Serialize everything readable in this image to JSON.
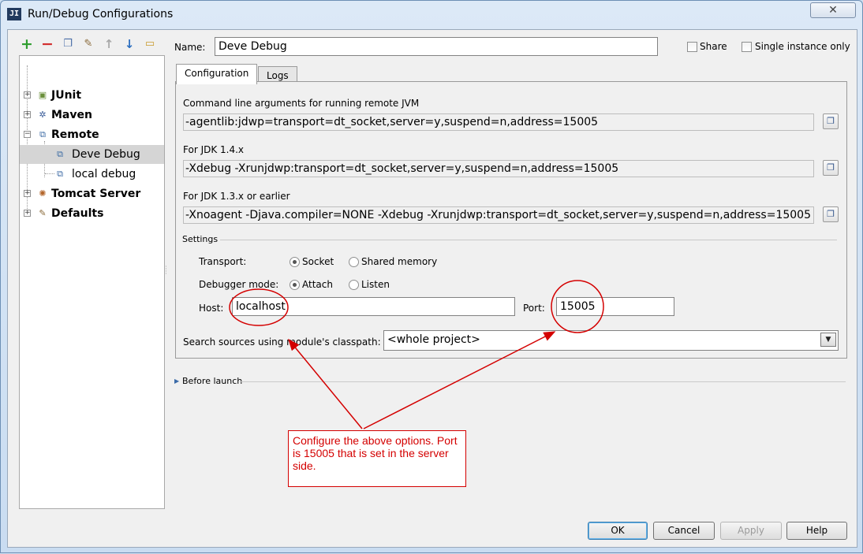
{
  "window": {
    "title": "Run/Debug Configurations",
    "app_icon_text": "JI",
    "close_glyph": "✕",
    "accent": "#d40000"
  },
  "toolbar": {
    "icons": [
      "add-icon",
      "remove-icon",
      "copy-icon",
      "wrench-icon",
      "arrow-up-icon",
      "arrow-down-icon",
      "folder-icon"
    ]
  },
  "tree": {
    "items": [
      {
        "label": "JUnit"
      },
      {
        "label": "Maven"
      },
      {
        "label": "Remote"
      },
      {
        "label": "Deve Debug"
      },
      {
        "label": "local debug"
      },
      {
        "label": "Tomcat Server"
      },
      {
        "label": "Defaults"
      }
    ]
  },
  "header": {
    "name_label": "Name:",
    "name_value": "Deve Debug",
    "share_label": "Share",
    "single_instance_label": "Single instance only"
  },
  "tabs": [
    {
      "label": "Configuration"
    },
    {
      "label": "Logs"
    }
  ],
  "config": {
    "cmdline_label": "Command line arguments for running remote JVM",
    "cmdline_value": "-agentlib:jdwp=transport=dt_socket,server=y,suspend=n,address=15005",
    "jdk14_label": "For JDK 1.4.x",
    "jdk14_value": "-Xdebug -Xrunjdwp:transport=dt_socket,server=y,suspend=n,address=15005",
    "jdk13_label": "For JDK 1.3.x or earlier",
    "jdk13_value": "-Xnoagent -Djava.compiler=NONE -Xdebug -Xrunjdwp:transport=dt_socket,server=y,suspend=n,address=15005",
    "settings_label": "Settings",
    "transport_label": "Transport:",
    "transport_options": [
      "Socket",
      "Shared memory"
    ],
    "debugger_mode_label": "Debugger mode:",
    "debugger_mode_options": [
      "Attach",
      "Listen"
    ],
    "host_label": "Host:",
    "host_value": "localhost",
    "port_label": "Port:",
    "port_value": "15005",
    "classpath_label": "Search sources using module's classpath:",
    "classpath_value": "<whole project>"
  },
  "before_launch": {
    "label": "Before launch"
  },
  "buttons": {
    "ok": "OK",
    "cancel": "Cancel",
    "apply": "Apply",
    "help": "Help"
  },
  "annotation": {
    "text": "Configure the above options. Port is 15005 that is set in the server side."
  }
}
